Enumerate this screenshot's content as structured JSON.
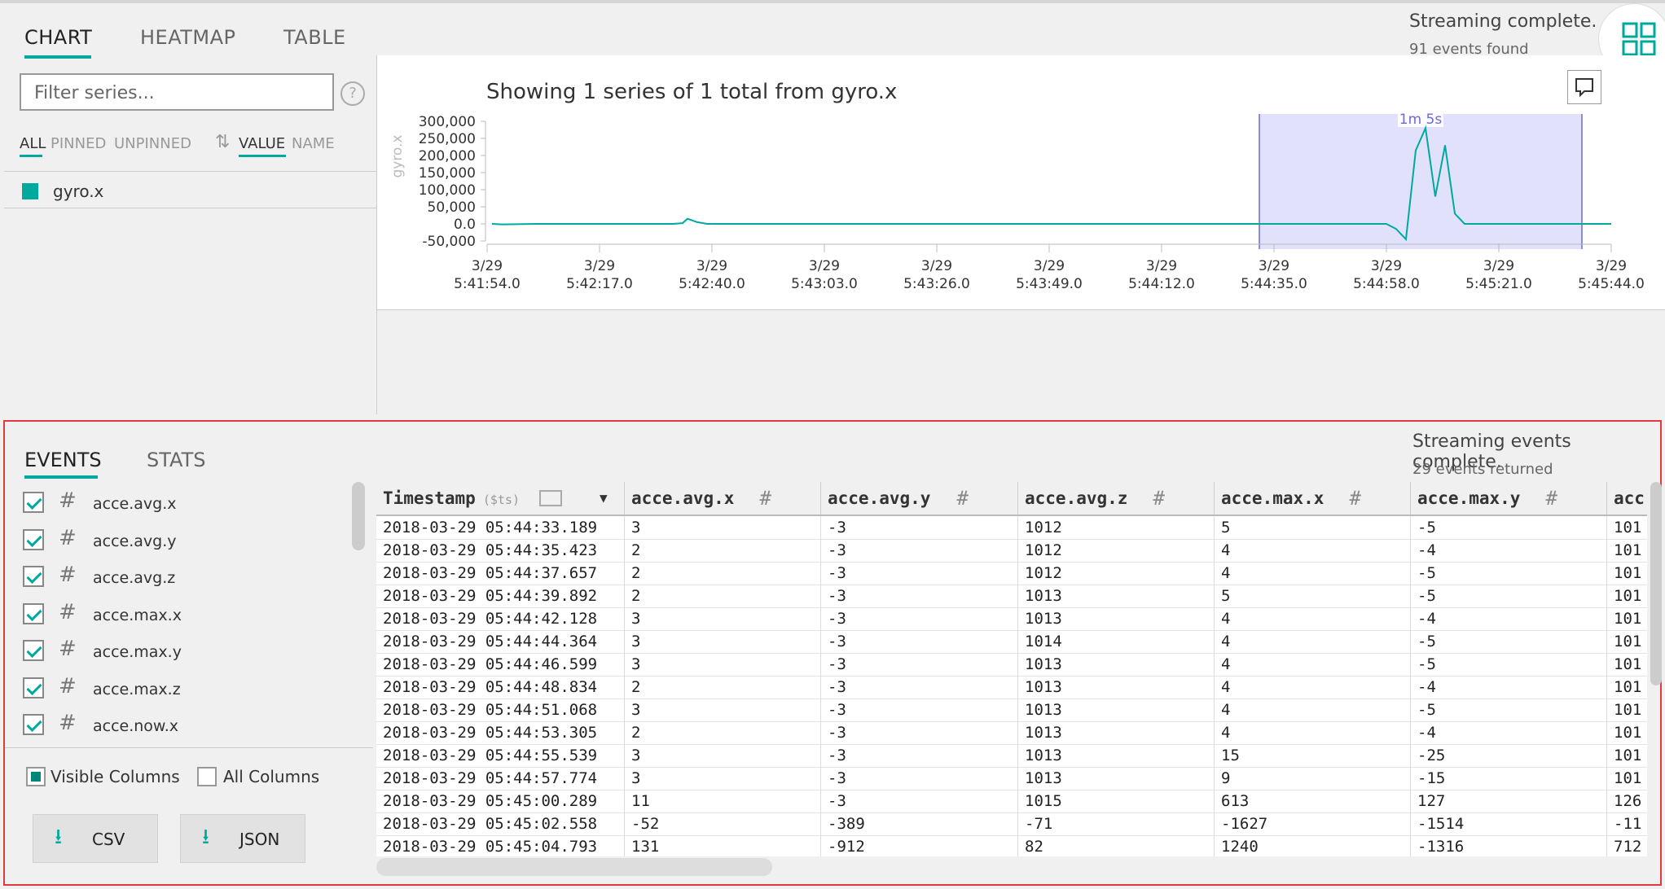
{
  "top_tabs": [
    "CHART",
    "HEATMAP",
    "TABLE"
  ],
  "status": {
    "streaming": "Streaming complete.",
    "events_found": "91 events found"
  },
  "filter": {
    "placeholder": "Filter series..."
  },
  "series_filters": [
    "ALL",
    "PINNED",
    "UNPINNED"
  ],
  "sort_options": [
    "VALUE",
    "NAME"
  ],
  "series_list": [
    {
      "name": "gyro.x",
      "color": "#00a99d"
    }
  ],
  "chart_data": {
    "type": "line",
    "title": "Showing 1 series of 1 total from gyro.x",
    "ylabel": "gyro.x",
    "y_ticks": [
      "300,000",
      "250,000",
      "200,000",
      "150,000",
      "100,000",
      "50,000",
      "0.0",
      "-50,000"
    ],
    "y_tick_values": [
      300000,
      250000,
      200000,
      150000,
      100000,
      50000,
      0,
      -50000
    ],
    "ylim": [
      -55000,
      310000
    ],
    "x_date_labels": [
      "3/29",
      "3/29",
      "3/29",
      "3/29",
      "3/29",
      "3/29",
      "3/29",
      "3/29",
      "3/29",
      "3/29",
      "3/29"
    ],
    "x_time_labels": [
      "5:41:54.0",
      "5:42:17.0",
      "5:42:40.0",
      "5:43:03.0",
      "5:43:26.0",
      "5:43:49.0",
      "5:44:12.0",
      "5:44:35.0",
      "5:44:58.0",
      "5:45:21.0",
      "5:45:44.0"
    ],
    "x_tick_seconds": [
      0,
      23,
      46,
      69,
      92,
      115,
      138,
      161,
      184,
      207,
      230
    ],
    "selection_label": "1m 5s",
    "selection_range_seconds": [
      158,
      224
    ],
    "series": [
      {
        "name": "gyro.x",
        "color": "#00a99d",
        "x": [
          1,
          3,
          10,
          20,
          30,
          35,
          38,
          40,
          41,
          43,
          45,
          50,
          60,
          80,
          100,
          120,
          140,
          160,
          170,
          180,
          184,
          186,
          188,
          190,
          192,
          194,
          196,
          198,
          200,
          202,
          204,
          206,
          210,
          230
        ],
        "values": [
          0,
          -1500,
          0,
          0,
          0,
          0,
          0,
          2000,
          15000,
          5000,
          0,
          0,
          0,
          0,
          0,
          0,
          0,
          0,
          0,
          0,
          0,
          -15000,
          -45000,
          215000,
          280000,
          80000,
          230000,
          30000,
          0,
          0,
          0,
          0,
          0,
          0
        ]
      }
    ]
  },
  "events_panel": {
    "tabs": [
      "EVENTS",
      "STATS"
    ],
    "streaming": "Streaming events complete.",
    "returned": "29 events returned",
    "columns_list": [
      "acce.avg.x",
      "acce.avg.y",
      "acce.avg.z",
      "acce.max.x",
      "acce.max.y",
      "acce.max.z",
      "acce.now.x"
    ],
    "visible_columns_label": "Visible Columns",
    "all_columns_label": "All Columns",
    "csv_label": "CSV",
    "json_label": "JSON"
  },
  "table": {
    "headers": [
      "Timestamp",
      "acce.avg.x",
      "acce.avg.y",
      "acce.avg.z",
      "acce.max.x",
      "acce.max.y",
      "acc"
    ],
    "timestamp_sub": "($ts)",
    "rows": [
      [
        "2018-03-29 05:44:33.189",
        "3",
        "-3",
        "1012",
        "5",
        "-5",
        "101"
      ],
      [
        "2018-03-29 05:44:35.423",
        "2",
        "-3",
        "1012",
        "4",
        "-4",
        "101"
      ],
      [
        "2018-03-29 05:44:37.657",
        "2",
        "-3",
        "1012",
        "4",
        "-5",
        "101"
      ],
      [
        "2018-03-29 05:44:39.892",
        "2",
        "-3",
        "1013",
        "5",
        "-5",
        "101"
      ],
      [
        "2018-03-29 05:44:42.128",
        "3",
        "-3",
        "1013",
        "4",
        "-4",
        "101"
      ],
      [
        "2018-03-29 05:44:44.364",
        "3",
        "-3",
        "1014",
        "4",
        "-5",
        "101"
      ],
      [
        "2018-03-29 05:44:46.599",
        "3",
        "-3",
        "1013",
        "4",
        "-5",
        "101"
      ],
      [
        "2018-03-29 05:44:48.834",
        "2",
        "-3",
        "1013",
        "4",
        "-4",
        "101"
      ],
      [
        "2018-03-29 05:44:51.068",
        "3",
        "-3",
        "1013",
        "4",
        "-5",
        "101"
      ],
      [
        "2018-03-29 05:44:53.305",
        "2",
        "-3",
        "1013",
        "4",
        "-4",
        "101"
      ],
      [
        "2018-03-29 05:44:55.539",
        "3",
        "-3",
        "1013",
        "15",
        "-25",
        "101"
      ],
      [
        "2018-03-29 05:44:57.774",
        "3",
        "-3",
        "1013",
        "9",
        "-15",
        "101"
      ],
      [
        "2018-03-29 05:45:00.289",
        "11",
        "-3",
        "1015",
        "613",
        "127",
        "126"
      ],
      [
        "2018-03-29 05:45:02.558",
        "-52",
        "-389",
        "-71",
        "-1627",
        "-1514",
        "-11"
      ],
      [
        "2018-03-29 05:45:04.793",
        "131",
        "-912",
        "82",
        "1240",
        "-1316",
        "712"
      ]
    ]
  }
}
